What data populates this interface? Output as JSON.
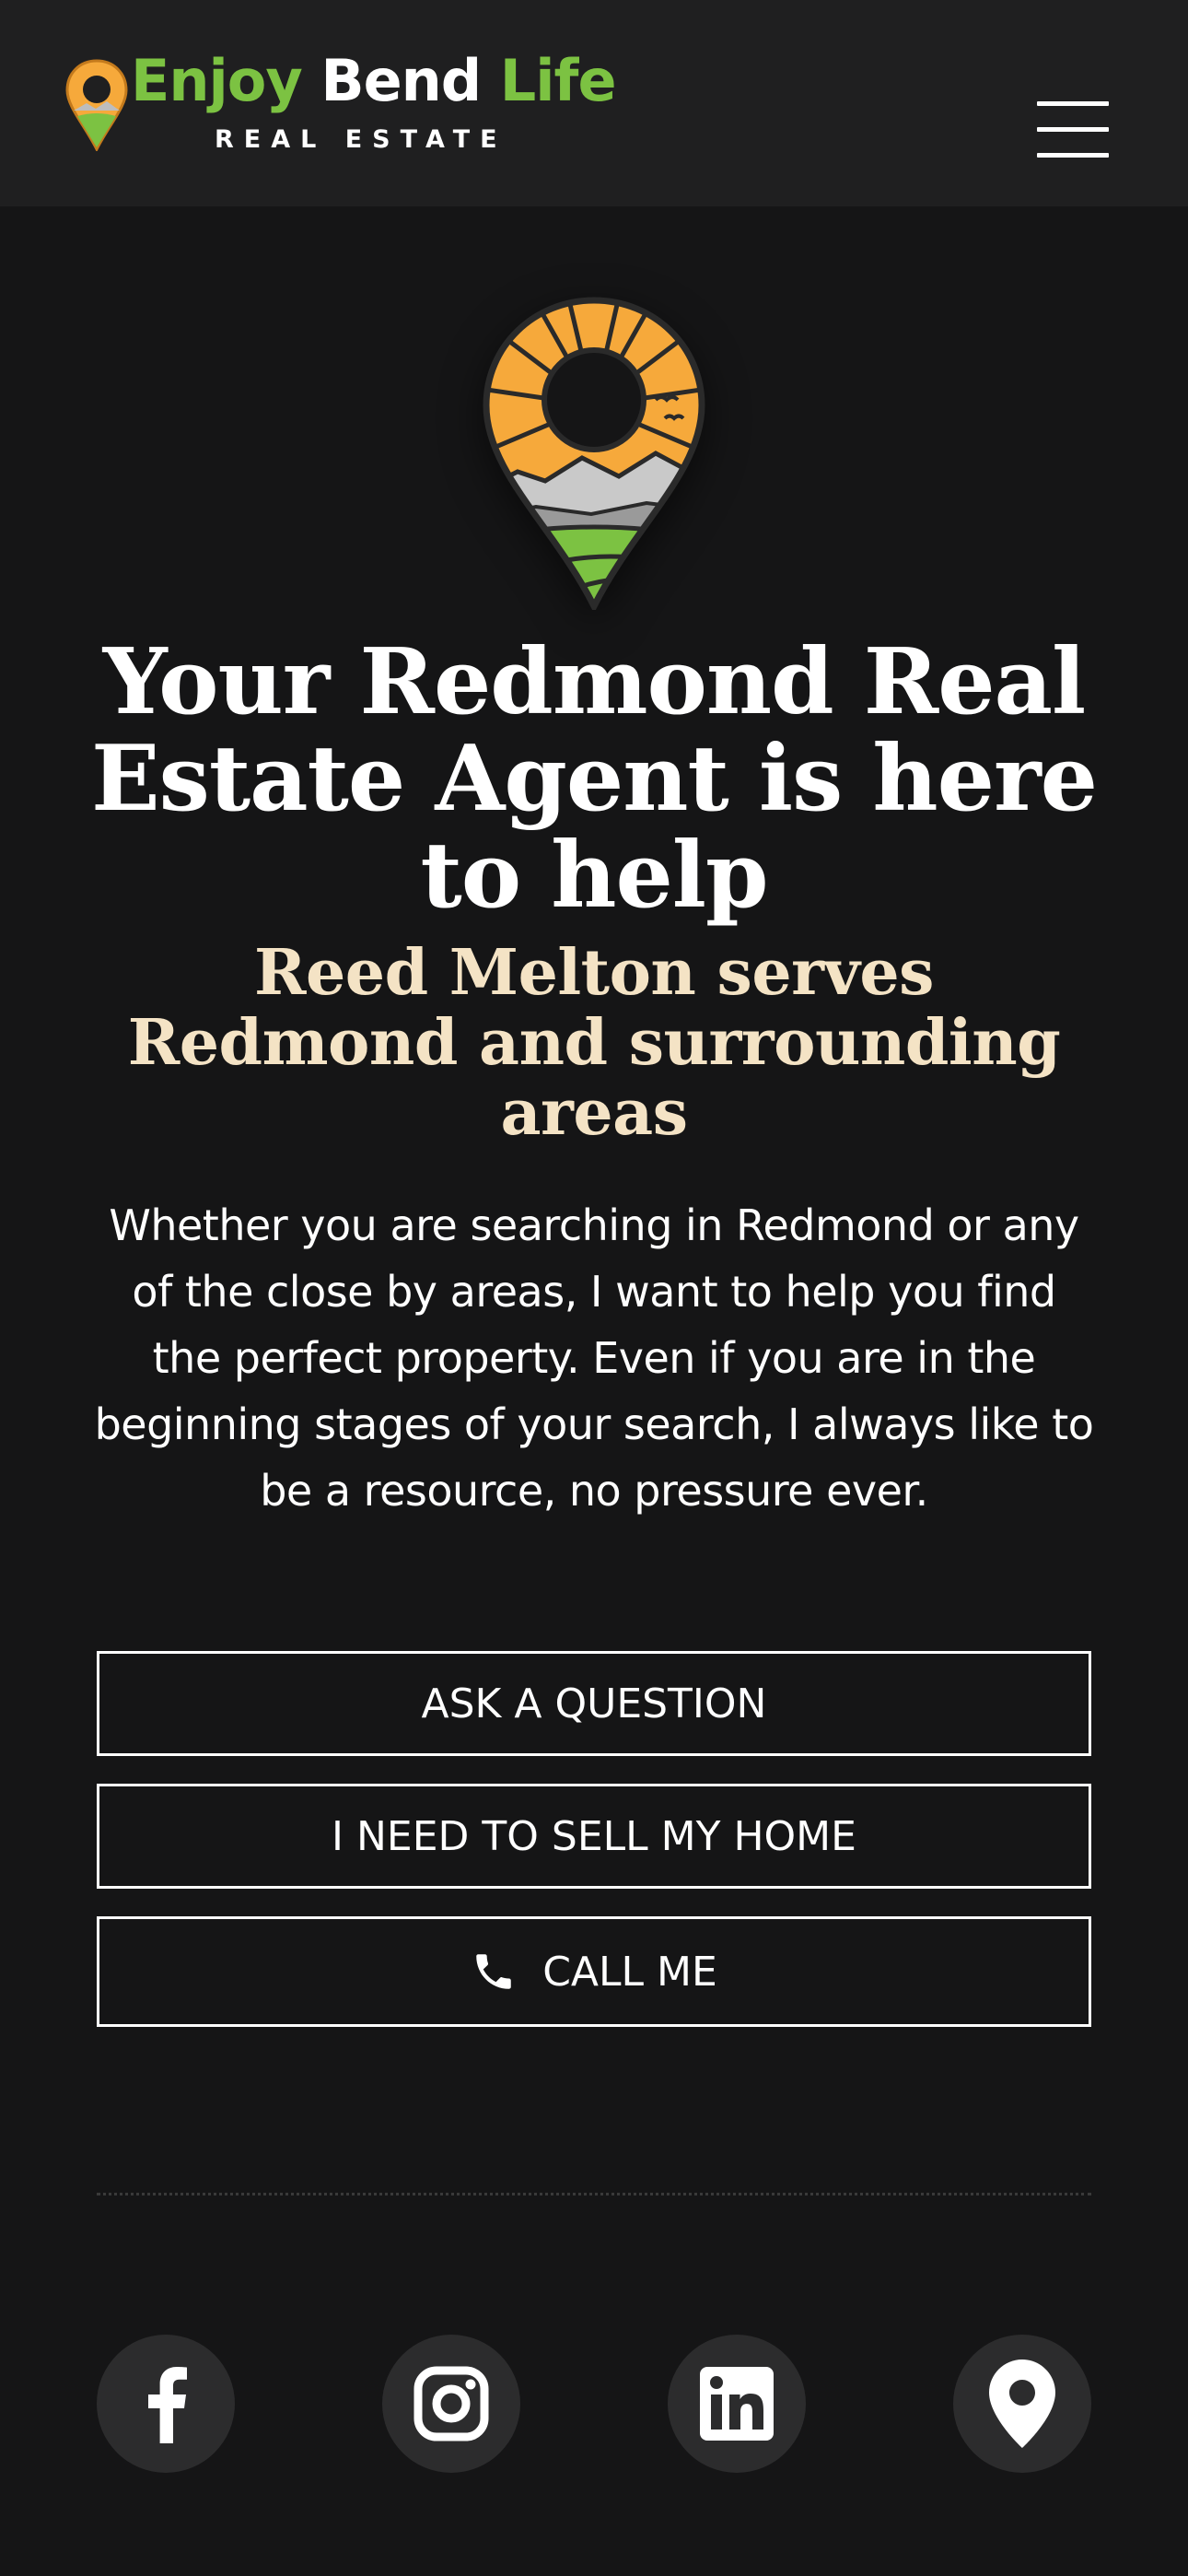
{
  "header": {
    "logo": {
      "word1": "Enjoy",
      "word2": "Bend",
      "word3": "Life",
      "subtitle": "REAL ESTATE"
    },
    "menu_icon": "hamburger-menu-icon"
  },
  "hero": {
    "pin_icon": "location-pin-landscape-icon",
    "title": "Your Redmond Real Estate Agent is here to help",
    "subtitle": "Reed Melton serves Redmond and surrounding areas",
    "body": "Whether you are searching in Redmond or any of the close by areas, I want to help you find the perfect property. Even if you are in the beginning stages of your search, I always like to be a resource, no pressure ever."
  },
  "buttons": {
    "ask": "ASK A QUESTION",
    "sell": "I NEED TO SELL MY HOME",
    "call": "CALL ME",
    "call_icon": "phone-icon"
  },
  "social": [
    {
      "icon": "facebook-icon"
    },
    {
      "icon": "instagram-icon"
    },
    {
      "icon": "linkedin-icon"
    },
    {
      "icon": "map-pin-icon"
    }
  ],
  "colors": {
    "background": "#151516",
    "header_bg": "#1f1f20",
    "logo_green": "#7cc242",
    "subtitle_cream": "#f4e3c5",
    "pin_orange": "#f6a93b",
    "social_bg": "#2c2c2d"
  }
}
